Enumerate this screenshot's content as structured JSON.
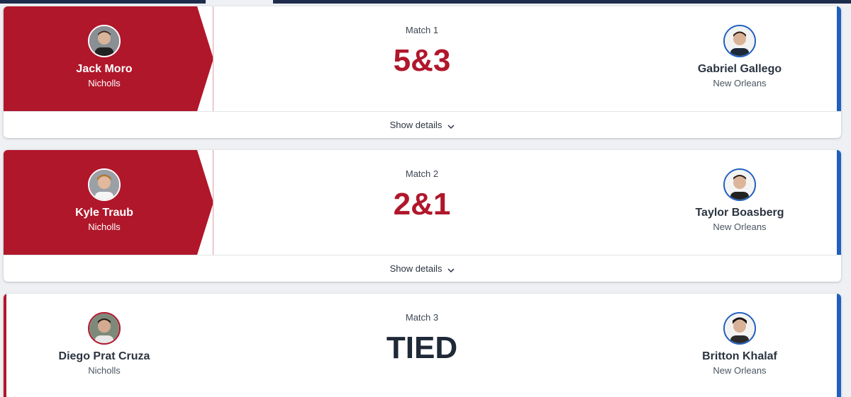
{
  "matches": [
    {
      "label": "Match 1",
      "result": "5&3",
      "left": {
        "name": "Jack Moro",
        "team": "Nicholls"
      },
      "right": {
        "name": "Gabriel Gallego",
        "team": "New Orleans"
      },
      "details": "Show details"
    },
    {
      "label": "Match 2",
      "result": "2&1",
      "left": {
        "name": "Kyle Traub",
        "team": "Nicholls"
      },
      "right": {
        "name": "Taylor Boasberg",
        "team": "New Orleans"
      },
      "details": "Show details"
    },
    {
      "label": "Match 3",
      "result": "TIED",
      "left": {
        "name": "Diego Prat Cruza",
        "team": "Nicholls"
      },
      "right": {
        "name": "Britton Khalaf",
        "team": "New Orleans"
      }
    }
  ],
  "colors": {
    "nicholls": "#b0172b",
    "new_orleans": "#1f5fbf",
    "navy": "#1f2d4d"
  }
}
